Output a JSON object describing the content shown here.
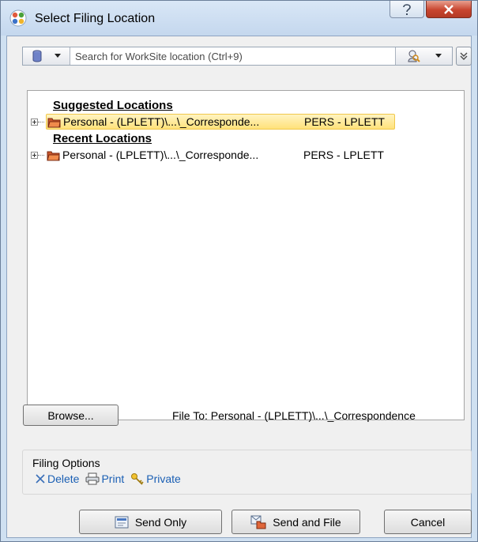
{
  "window": {
    "title": "Select Filing Location",
    "help_glyph": "?",
    "close_glyph": "X"
  },
  "search": {
    "placeholder": "Search for WorkSite location (Ctrl+9)",
    "db_icon": "database-icon",
    "scope_icon": "search-scope-icon",
    "expand_icon": "double-chevron-down-icon"
  },
  "tree": {
    "groups": [
      {
        "heading": "Suggested Locations",
        "items": [
          {
            "name": "Personal - (LPLETT)\\...\\_Corresponde...",
            "database": "PERS - LPLETT",
            "selected": true
          }
        ]
      },
      {
        "heading": "Recent Locations",
        "items": [
          {
            "name": "Personal - (LPLETT)\\...\\_Corresponde...",
            "database": "PERS - LPLETT",
            "selected": false
          }
        ]
      }
    ]
  },
  "browse": {
    "button_label": "Browse...",
    "file_to": "File To: Personal - (LPLETT)\\...\\_Correspondence"
  },
  "filing_options": {
    "label": "Filing Options",
    "delete_label": "Delete",
    "print_label": "Print",
    "private_label": "Private"
  },
  "buttons": {
    "send_only": "Send Only",
    "send_and_file": "Send and File",
    "cancel": "Cancel"
  },
  "colors": {
    "link": "#1a5fb4",
    "selection": "#ffe27a",
    "close": "#c8452f"
  }
}
